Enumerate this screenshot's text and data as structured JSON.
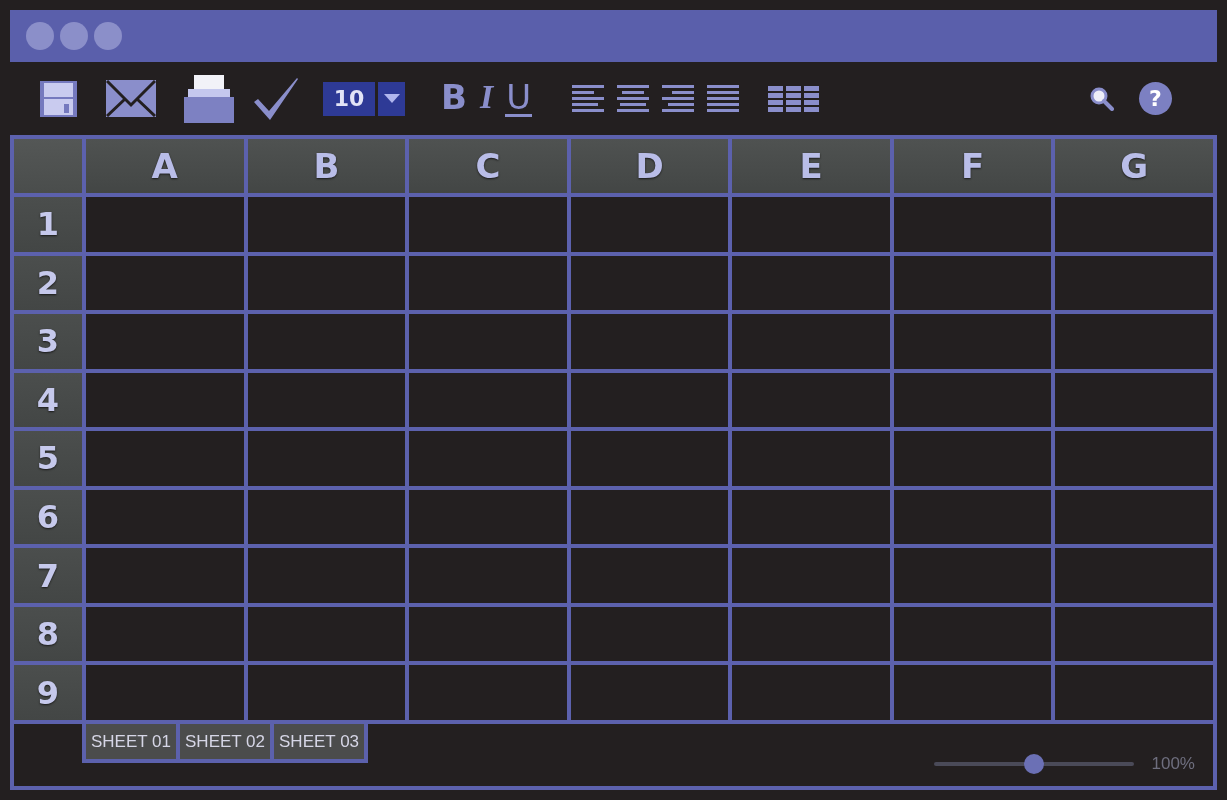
{
  "toolbar": {
    "font_size": {
      "value": "10"
    },
    "format_buttons": [
      {
        "kind": "bold",
        "label": "B"
      },
      {
        "kind": "italic",
        "label": "I"
      },
      {
        "kind": "underline",
        "label": "U"
      }
    ],
    "help_button": {
      "label": "?"
    }
  },
  "sheet": {
    "columns": [
      "A",
      "B",
      "C",
      "D",
      "E",
      "F",
      "G"
    ],
    "rows": [
      "1",
      "2",
      "3",
      "4",
      "5",
      "6",
      "7",
      "8",
      "9"
    ]
  },
  "sheet_tabs": [
    {
      "label": "SHEET 01",
      "selected": false
    },
    {
      "label": "SHEET 02",
      "selected": false
    },
    {
      "label": "SHEET 03",
      "selected": false
    }
  ],
  "zoom": {
    "level": 0.5,
    "label": "100%"
  }
}
